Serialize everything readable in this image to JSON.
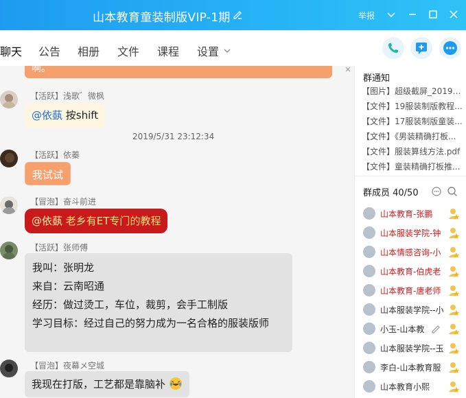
{
  "window": {
    "title": "山本教育童装制版VIP-1期",
    "report_label": "举报"
  },
  "tabs": [
    {
      "label": "聊天"
    },
    {
      "label": "公告"
    },
    {
      "label": "相册"
    },
    {
      "label": "文件"
    },
    {
      "label": "课程"
    },
    {
      "label": "设置"
    }
  ],
  "messages": {
    "top_fragment": "啊。",
    "m1": {
      "sender": "【活跃】浅歌゛微枫",
      "mention": "@依蓺",
      "text": "按shift"
    },
    "timestamp": "2019/5/31 23:12:34",
    "m2": {
      "sender": "【活跃】依蓁",
      "text": "我试试"
    },
    "m3": {
      "sender": "【冒泡】奋斗前进",
      "mention": "@依蓺",
      "text": "老乡有ET专门的教程"
    },
    "m4": {
      "sender": "【活跃】张师傅",
      "lines": [
        "我叫：张明龙",
        "来自：云南昭通",
        "经历：做过烫工，车位，裁剪，会手工制版",
        "学习目标：经过自己的努力成为一名合格的服装版师"
      ]
    },
    "m5": {
      "sender": "【冒泡】夜幕メ空城",
      "text": "我现在打版，工艺都是靠脑补"
    }
  },
  "side": {
    "notice_title": "群通知",
    "notices": [
      "【图片】超级截屏_20190...",
      "【文件】19服装制版教程...",
      "【文件】17服装制版童装...",
      "【文件】《男装精确打板...",
      "【文件】服装算线方法.pdf",
      "【文件】童装精确打板推..."
    ],
    "members_title": "群成员 40/50",
    "members": [
      {
        "name": "山本教育-张鹏",
        "color": "red"
      },
      {
        "name": "山本服装学院-钟",
        "color": "red"
      },
      {
        "name": "山本情感咨询-小",
        "color": "red"
      },
      {
        "name": "山本教育-伯虎老",
        "color": "red"
      },
      {
        "name": "山本教育-唐老师",
        "color": "red"
      },
      {
        "name": "山本服装学院--小",
        "color": "dark"
      },
      {
        "name": "小玉-山本教",
        "color": "dark"
      },
      {
        "name": "山本服装学院--玉",
        "color": "dark"
      },
      {
        "name": "李白-山本教育服",
        "color": "dark"
      },
      {
        "name": "山本教育小熙",
        "color": "dark"
      }
    ]
  },
  "colors": {
    "titlebar": "#1e9bf0",
    "accent": "#1e9bf0",
    "red_bubble": "#c8191b",
    "orange_bubble": "#f6a06d"
  },
  "icons": {
    "edit": "edit-icon",
    "call": "phone-icon",
    "share": "share-icon",
    "more": "more-icon"
  }
}
